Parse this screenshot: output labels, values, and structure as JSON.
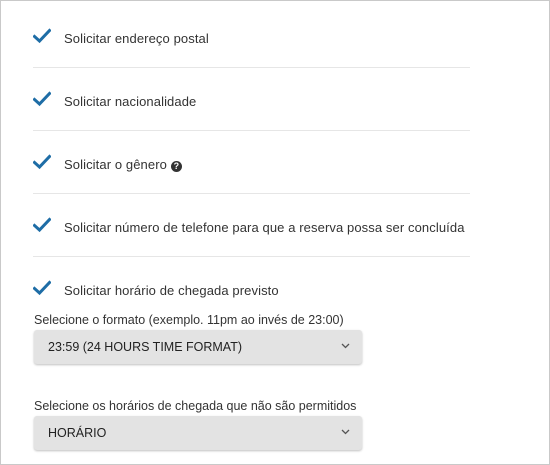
{
  "options": [
    {
      "label": "Solicitar endereço postal",
      "checked": true
    },
    {
      "label": "Solicitar nacionalidade",
      "checked": true
    },
    {
      "label": "Solicitar o gênero",
      "checked": true,
      "help_icon": "question-circle-icon"
    },
    {
      "label": "Solicitar número de telefone para que a reserva possa ser concluída",
      "checked": true
    },
    {
      "label": "Solicitar horário de chegada previsto",
      "checked": true
    }
  ],
  "time_format": {
    "label": "Selecione o formato (exemplo. 11pm ao invés de 23:00)",
    "selected": "23:59 (24 HOURS TIME FORMAT)"
  },
  "disallowed_arrival": {
    "label": "Selecione os horários de chegada que não são permitidos",
    "selected": "HORÁRIO"
  },
  "colors": {
    "check": "#1e6da6",
    "select_bg": "#e3e3e3",
    "divider": "#e6e6e6"
  }
}
